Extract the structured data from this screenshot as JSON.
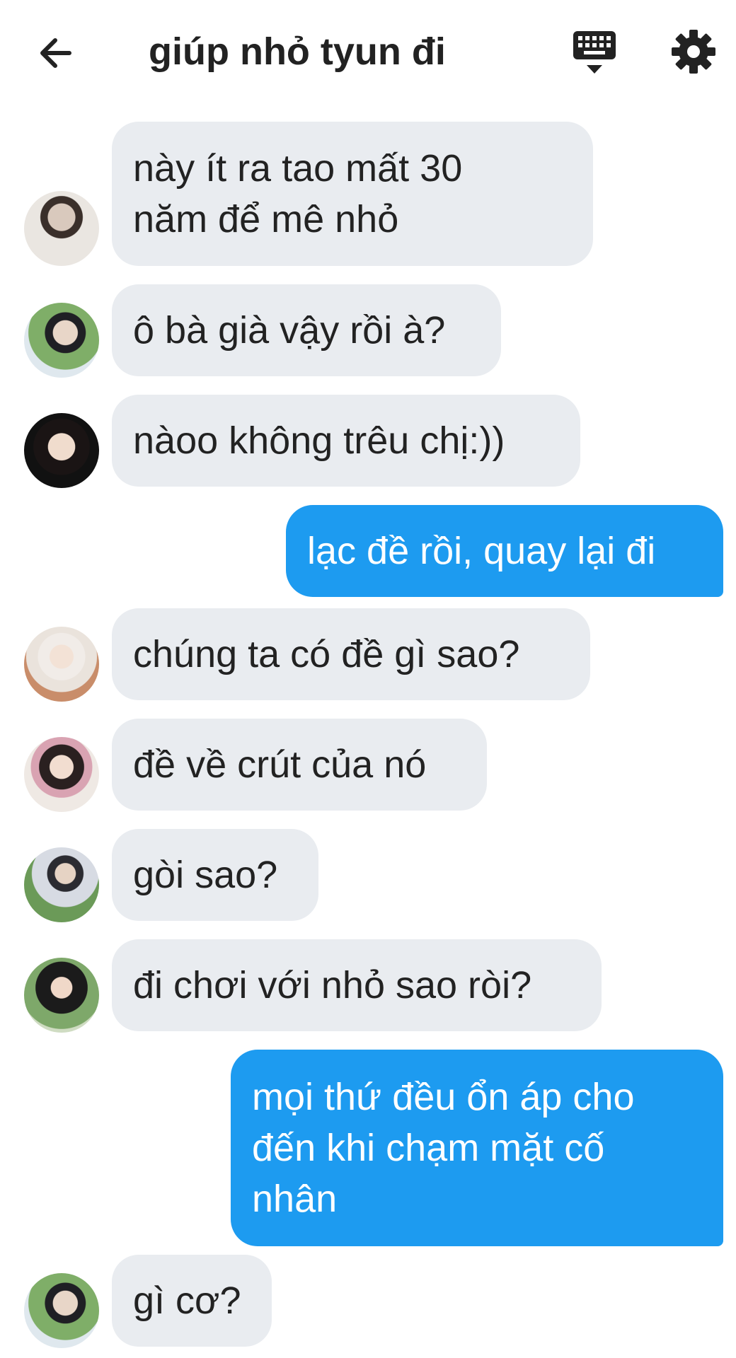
{
  "header": {
    "title": "giúp nhỏ tyun đi",
    "back_icon": "arrow-left-icon",
    "keyboard_icon": "keyboard-icon",
    "settings_icon": "gear-icon"
  },
  "colors": {
    "incoming_bubble": "#e9ecf0",
    "outgoing_bubble": "#1d9bf0"
  },
  "messages": [
    {
      "text": "này ít ra tao mất 30\nnăm để mê nhỏ",
      "side": "in"
    },
    {
      "text": "ô bà già vậy rồi à?",
      "side": "in"
    },
    {
      "text": "nàoo không trêu chị:))",
      "side": "in"
    },
    {
      "text": "lạc đề rồi, quay lại đi",
      "side": "out"
    },
    {
      "text": "chúng ta có đề gì sao?",
      "side": "in"
    },
    {
      "text": "đề về crút của nó",
      "side": "in"
    },
    {
      "text": "gòi sao?",
      "side": "in"
    },
    {
      "text": "đi chơi với nhỏ sao ròi?",
      "side": "in"
    },
    {
      "text": "mọi thứ đều ổn áp cho\nđến khi chạm mặt cố\nnhân",
      "side": "out"
    },
    {
      "text": "gì cơ?",
      "side": "in"
    }
  ]
}
